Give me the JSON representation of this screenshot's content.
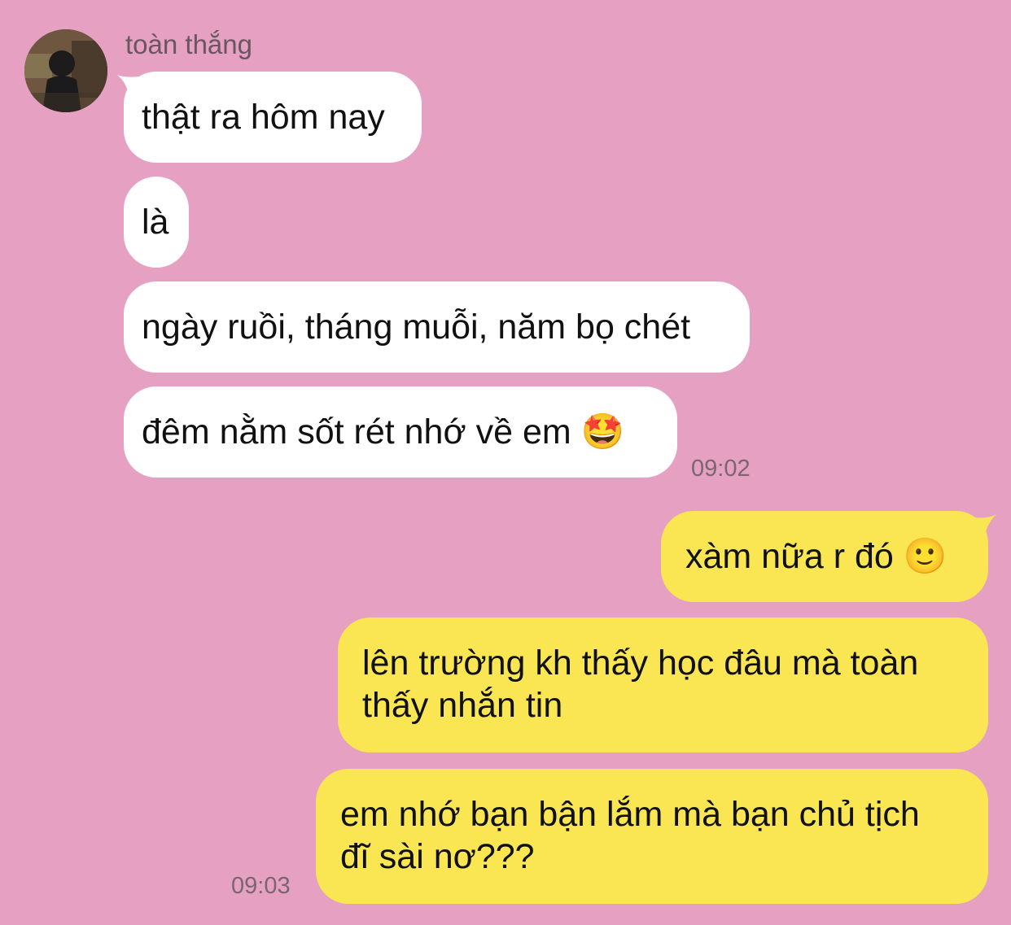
{
  "chat": {
    "sender_name": "toàn thắng",
    "incoming": [
      {
        "text": "thật ra hôm nay"
      },
      {
        "text": "là"
      },
      {
        "text": "ngày ruồi, tháng muỗi, năm bọ chét"
      },
      {
        "text": "đêm nằm sốt rét nhớ về em",
        "emoji": "🤩"
      }
    ],
    "incoming_time": "09:02",
    "outgoing": [
      {
        "text": "xàm nữa r đó",
        "emoji": "🙂"
      },
      {
        "text": "lên trường kh thấy học đâu mà toàn\nthấy nhắn tin"
      },
      {
        "text": "em nhớ bạn bận lắm mà bạn chủ tịch\nđĩ sài nơ???"
      }
    ],
    "outgoing_time": "09:03"
  },
  "colors": {
    "background": "#E5A0C2",
    "incoming_bubble": "#FFFFFF",
    "outgoing_bubble": "#F9E652"
  }
}
